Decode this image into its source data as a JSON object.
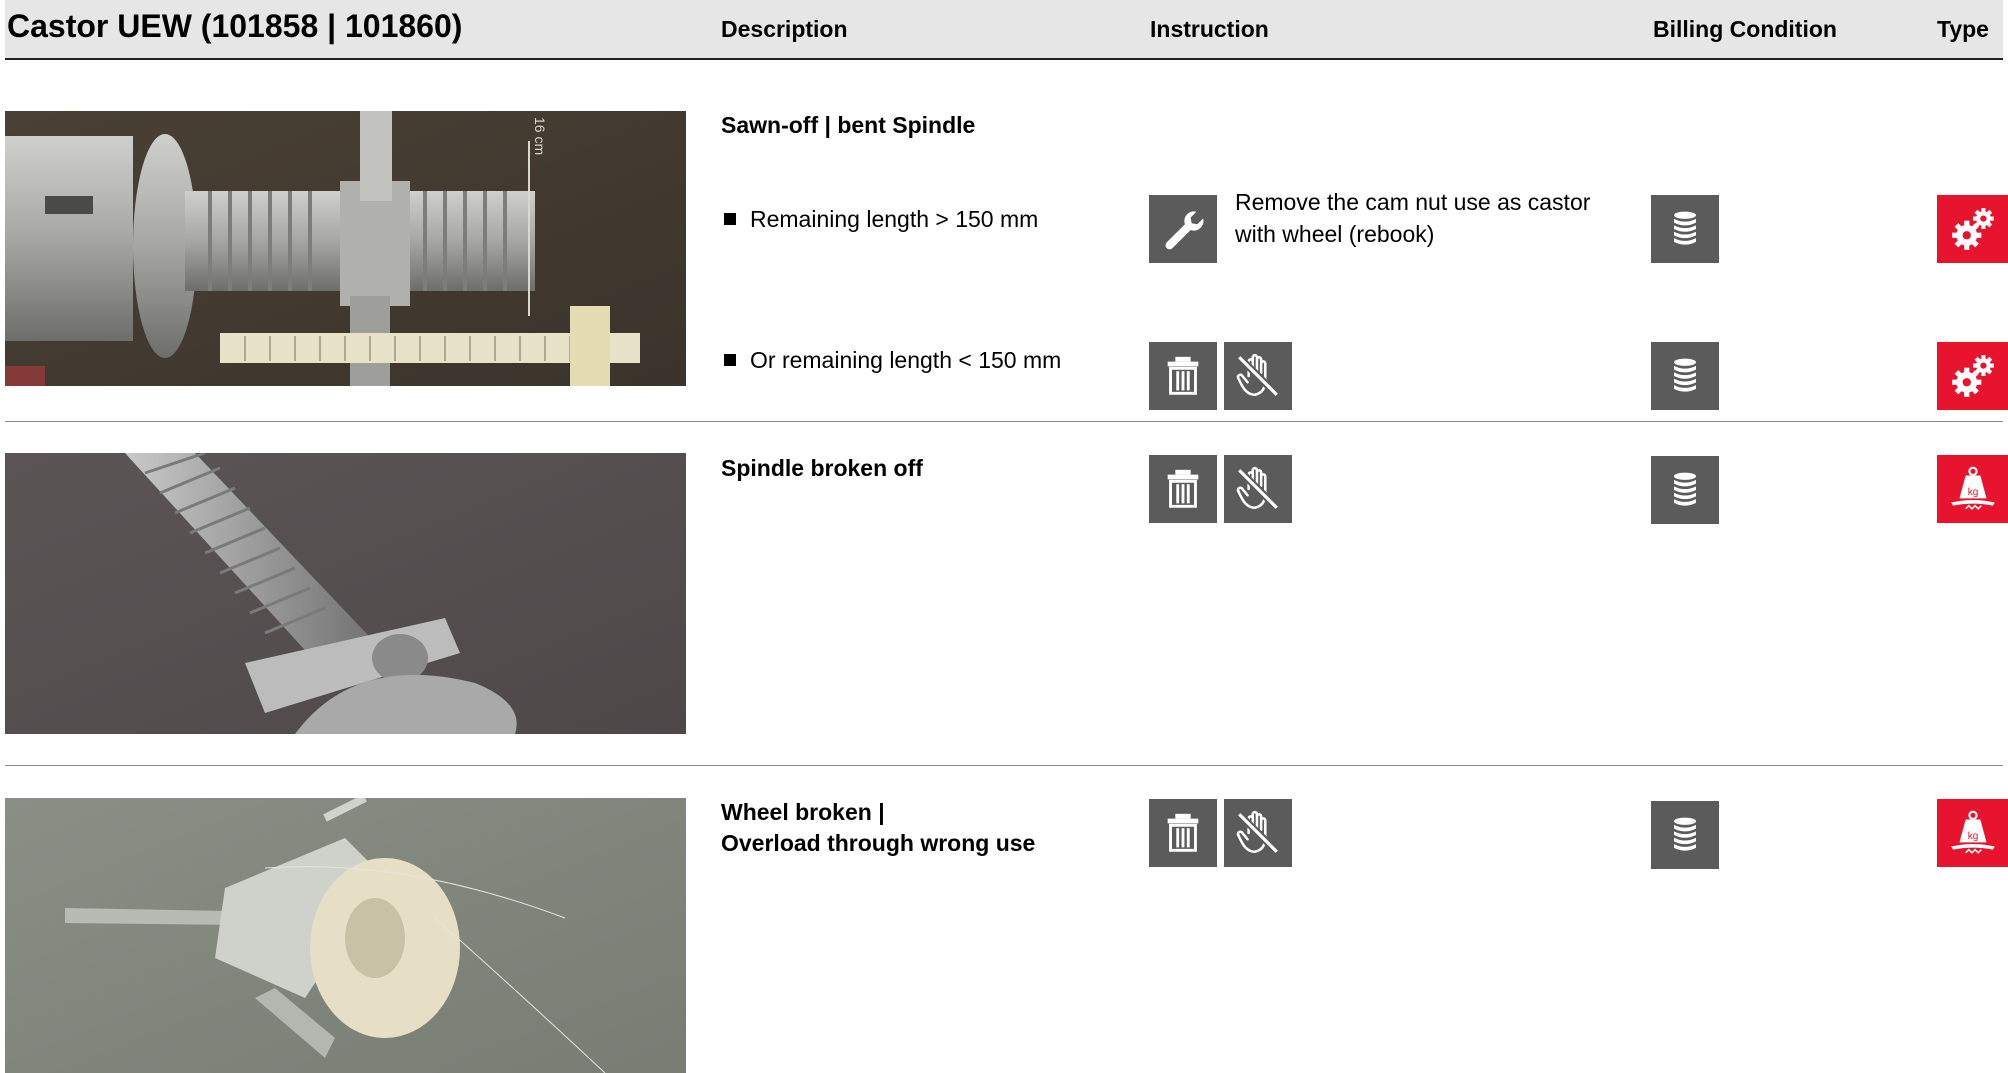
{
  "header": {
    "title": "Castor UEW (101858 | 101860)",
    "col_description": "Description",
    "col_instruction": "Instruction",
    "col_billing": "Billing Condition",
    "col_type": "Type"
  },
  "rows": [
    {
      "title": "Sawn-off | bent Spindle",
      "photo_label": "16 cm",
      "items": [
        {
          "text": "Remaining length > 150 mm",
          "instruction": "Remove the cam nut use as castor with wheel  (rebook)",
          "instruction_icons": [
            "wrench-icon"
          ],
          "billing_icon": "coin-stack-icon",
          "type_icon": "gears-icon"
        },
        {
          "text": "Or remaining length < 150 mm",
          "instruction_icons": [
            "trash-icon",
            "no-repair-hand-icon"
          ],
          "billing_icon": "coin-stack-icon",
          "type_icon": "gears-icon"
        }
      ]
    },
    {
      "title": "Spindle broken off",
      "instruction_icons": [
        "trash-icon",
        "no-repair-hand-icon"
      ],
      "billing_icon": "coin-stack-icon",
      "type_icon": "weight-kg-icon",
      "weight_label": "kg"
    },
    {
      "title_line1": "Wheel broken |",
      "title_line2": "Overload through wrong use",
      "instruction_icons": [
        "trash-icon",
        "no-repair-hand-icon"
      ],
      "billing_icon": "coin-stack-icon",
      "type_icon": "weight-kg-icon",
      "weight_label": "kg"
    }
  ],
  "colors": {
    "icon_gray": "#5b5b5b",
    "type_red": "#e8132c",
    "header_bg": "#e6e6e6"
  }
}
